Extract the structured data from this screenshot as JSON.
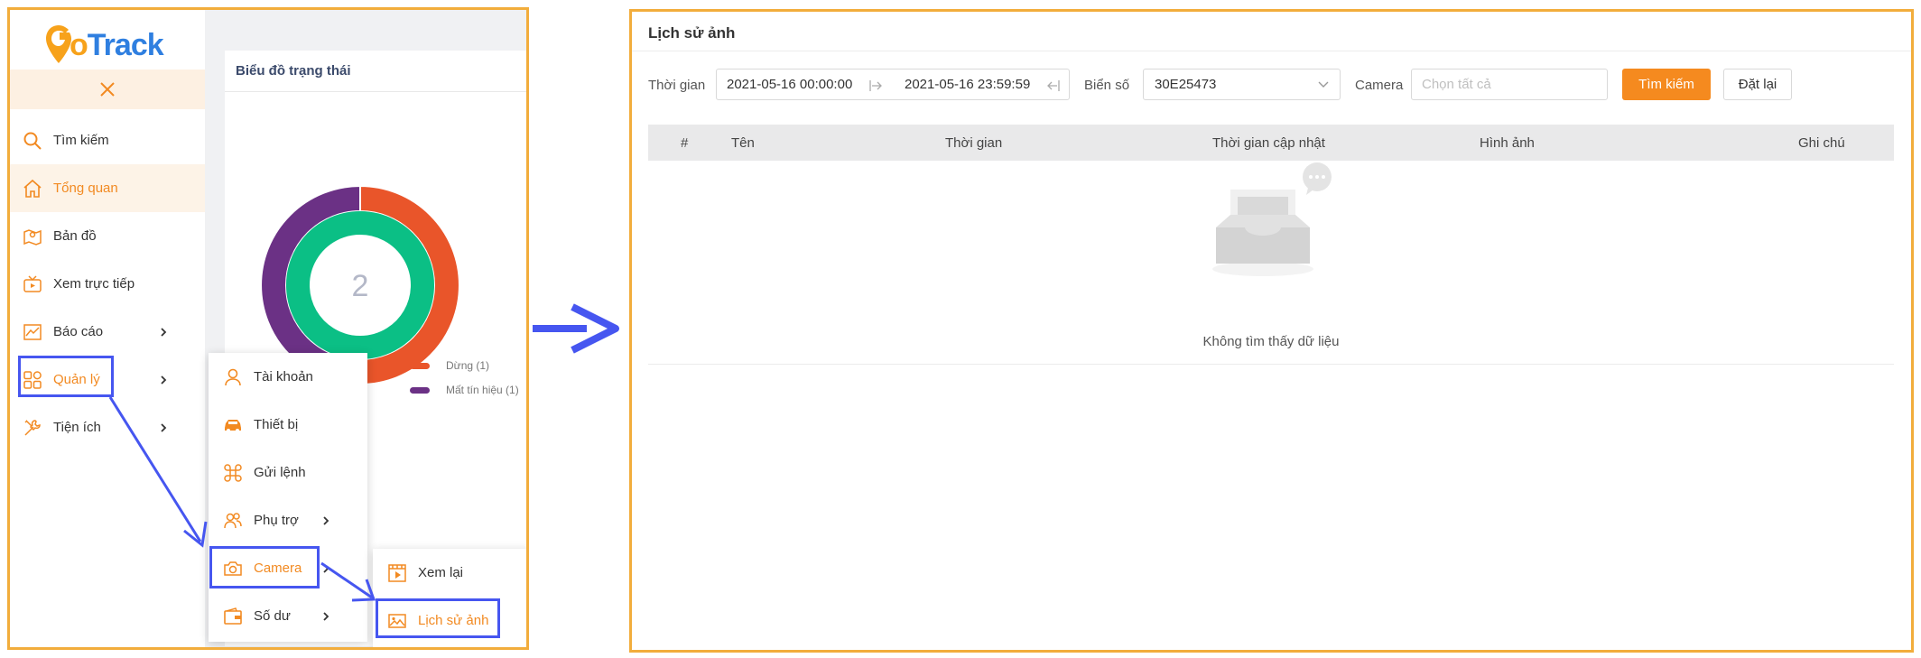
{
  "app": {
    "logo_g": "G",
    "logo_o": "o",
    "logo_track": "Track"
  },
  "sidebar": {
    "items": [
      {
        "label": "Tìm kiếm"
      },
      {
        "label": "Tổng quan"
      },
      {
        "label": "Bản đồ"
      },
      {
        "label": "Xem trực tiếp"
      },
      {
        "label": "Báo cáo"
      },
      {
        "label": "Quản lý"
      },
      {
        "label": "Tiện ích"
      }
    ]
  },
  "status_chart": {
    "title": "Biểu đồ trạng thái",
    "total": "2",
    "legend": [
      {
        "label": "Dừng (1)",
        "color": "#e9552a"
      },
      {
        "label": "Mất tín hiệu (1)",
        "color": "#6b3185"
      }
    ],
    "partial_label": ")"
  },
  "chart_data": {
    "type": "pie",
    "title": "Biểu đồ trạng thái",
    "center_label": "2",
    "outer_ring": [
      {
        "name": "Dừng",
        "value": 1,
        "color": "#e9552a"
      },
      {
        "name": "Mất tín hiệu",
        "value": 1,
        "color": "#6b3185"
      }
    ],
    "inner_ring": [
      {
        "value": 2,
        "color": "#0bbf85"
      }
    ]
  },
  "management_menu": {
    "items": [
      {
        "label": "Tài khoản"
      },
      {
        "label": "Thiết bị"
      },
      {
        "label": "Gửi lệnh"
      },
      {
        "label": "Phụ trợ"
      },
      {
        "label": "Camera"
      },
      {
        "label": "Số dư"
      }
    ]
  },
  "camera_menu": {
    "items": [
      {
        "label": "Xem lại"
      },
      {
        "label": "Lịch sử ảnh"
      }
    ]
  },
  "photo_history": {
    "title": "Lịch sử ảnh",
    "filters": {
      "time_label": "Thời gian",
      "start": "2021-05-16 00:00:00",
      "end": "2021-05-16 23:59:59",
      "plate_label": "Biển số",
      "plate_value": "30E25473",
      "camera_label": "Camera",
      "camera_placeholder": "Chọn tất cả",
      "search_button": "Tìm kiếm",
      "reset_button": "Đặt lại"
    },
    "columns": [
      "#",
      "Tên",
      "Thời gian",
      "Thời gian cập nhật",
      "Hình ảnh",
      "Ghi chú"
    ],
    "empty_text": "Không tìm thấy dữ liệu"
  },
  "colors": {
    "accent": "#f58a1f",
    "highlight_box": "#4656f0",
    "panel_border": "#f2ad3c",
    "ring_green": "#0bbf85",
    "ring_orange": "#e9552a",
    "ring_purple": "#6b3185"
  }
}
